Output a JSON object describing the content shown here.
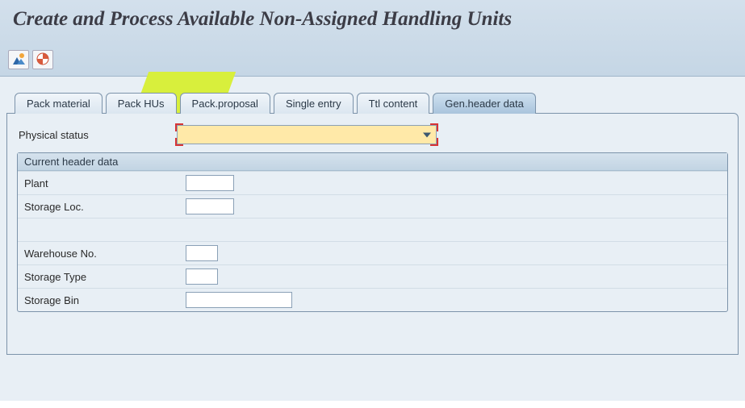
{
  "page": {
    "title": "Create and Process Available Non-Assigned Handling Units"
  },
  "toolbar": {
    "icon1_name": "mountain-sun-icon",
    "icon2_name": "target-icon"
  },
  "tabs": [
    {
      "label": "Pack material",
      "active": false
    },
    {
      "label": "Pack HUs",
      "active": false
    },
    {
      "label": "Pack.proposal",
      "active": false
    },
    {
      "label": "Single entry",
      "active": false
    },
    {
      "label": "Ttl content",
      "active": false
    },
    {
      "label": "Gen.header data",
      "active": true
    }
  ],
  "gen_header": {
    "physical_status": {
      "label": "Physical status",
      "value": ""
    },
    "group_title": "Current header data",
    "fields": {
      "plant": {
        "label": "Plant",
        "value": ""
      },
      "storage_loc": {
        "label": "Storage Loc.",
        "value": ""
      },
      "warehouse_no": {
        "label": "Warehouse No.",
        "value": ""
      },
      "storage_type": {
        "label": "Storage Type",
        "value": ""
      },
      "storage_bin": {
        "label": "Storage Bin",
        "value": ""
      }
    }
  }
}
